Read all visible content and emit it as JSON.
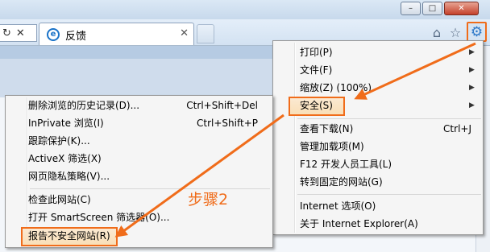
{
  "window": {
    "minimize_glyph": "–",
    "maximize_glyph": "□",
    "close_glyph": "✕"
  },
  "toolbar": {
    "refresh_glyph": "↻",
    "stop_glyph": "✕",
    "ie_glyph": "e",
    "home_glyph": "⌂",
    "favorites_glyph": "☆",
    "gear_glyph": "⚙"
  },
  "tab": {
    "title": "反馈",
    "close_glyph": "✕"
  },
  "tools_menu": {
    "items": [
      {
        "label": "打印(P)",
        "has_submenu": true
      },
      {
        "label": "文件(F)",
        "has_submenu": true
      },
      {
        "label": "缩放(Z) (100%)",
        "has_submenu": true
      },
      {
        "label": "安全(S)",
        "has_submenu": true,
        "highlighted": true
      },
      {
        "label": "查看下载(N)",
        "shortcut": "Ctrl+J"
      },
      {
        "label": "管理加载项(M)"
      },
      {
        "label": "F12 开发人员工具(L)"
      },
      {
        "label": "转到固定的网站(G)"
      },
      {
        "label": "Internet 选项(O)"
      },
      {
        "label": "关于 Internet Explorer(A)"
      }
    ],
    "arrow_glyph": "▶"
  },
  "safety_menu": {
    "items": [
      {
        "label": "删除浏览的历史记录(D)...",
        "shortcut": "Ctrl+Shift+Del"
      },
      {
        "label": "InPrivate 浏览(I)",
        "shortcut": "Ctrl+Shift+P"
      },
      {
        "label": "跟踪保护(K)..."
      },
      {
        "label": "ActiveX 筛选(X)"
      },
      {
        "label": "网页隐私策略(V)..."
      },
      {
        "label": "检查此网站(C)"
      },
      {
        "label": "打开 SmartScreen 筛选器(O)..."
      },
      {
        "label": "报告不安全网站(R)",
        "highlighted": true
      }
    ]
  },
  "annotation": {
    "step_label": "步骤2",
    "color": "#f06c1a"
  }
}
